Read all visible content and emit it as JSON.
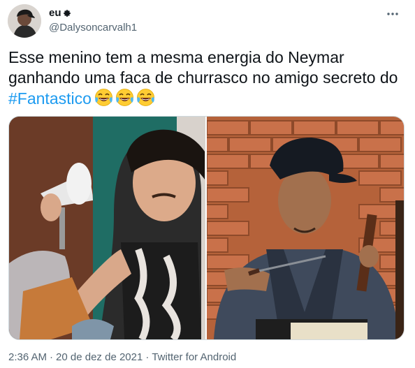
{
  "author": {
    "display_name": "eu",
    "handle": "@Dalysoncarvalh1"
  },
  "tweet": {
    "text": "Esse menino tem a mesma energia do Neymar ganhando uma faca de churrasco no amigo secreto do ",
    "hashtag": "#Fantastico",
    "emoji": "😂😂😂"
  },
  "meta": {
    "time": "2:36 AM",
    "separator": "·",
    "date": "20 de dez de 2021",
    "source": "Twitter for Android"
  },
  "colors": {
    "link": "#1d9bf0",
    "secondary_text": "#536471",
    "primary_text": "#0f1419"
  },
  "icons": [
    "verified-badge-icon",
    "more-options-icon"
  ]
}
